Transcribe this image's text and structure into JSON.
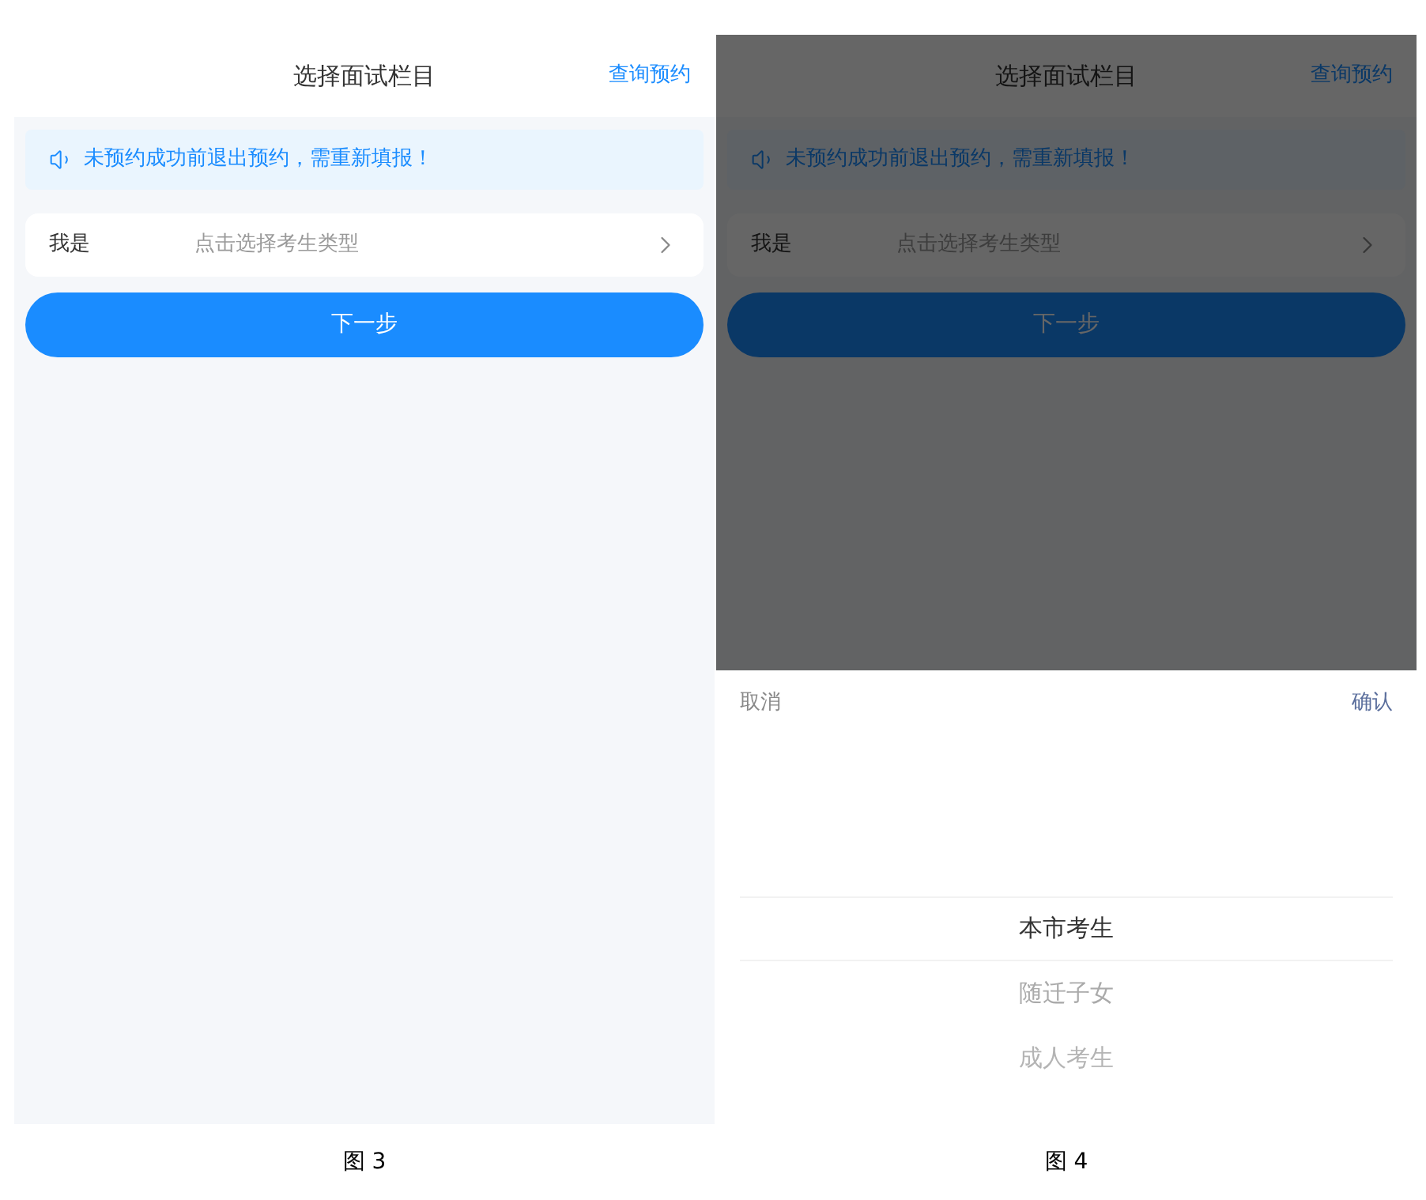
{
  "figures": [
    {
      "caption": "图 3",
      "screen": {
        "title": "选择面试栏目",
        "link": "查询预约",
        "notice": "未预约成功前退出预约，需重新填报！",
        "field": {
          "label": "我是",
          "placeholder": "点击选择考生类型"
        },
        "button": "下一步"
      }
    },
    {
      "caption": "图 4",
      "screen": {
        "title": "选择面试栏目",
        "link": "查询预约",
        "notice": "未预约成功前退出预约，需重新填报！",
        "field": {
          "label": "我是",
          "placeholder": "点击选择考生类型"
        },
        "button": "下一步"
      },
      "picker": {
        "cancel": "取消",
        "confirm": "确认",
        "options": [
          {
            "label": "本市考生",
            "selected": true
          },
          {
            "label": "随迁子女",
            "selected": false
          },
          {
            "label": "成人考生",
            "selected": false
          }
        ]
      }
    }
  ]
}
